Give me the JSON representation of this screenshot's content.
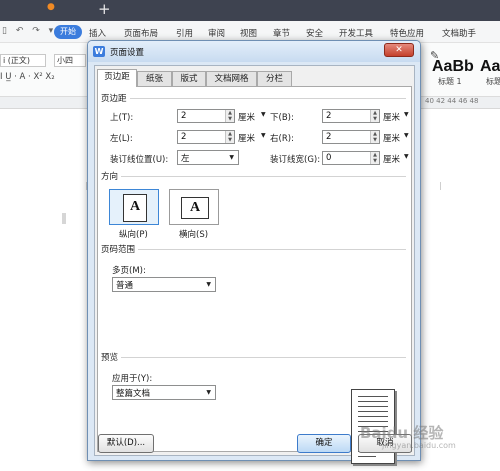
{
  "app": {
    "menu_start": "开始",
    "menus": [
      "插入",
      "页面布局",
      "引用",
      "审阅",
      "视图",
      "章节",
      "安全",
      "开发工具",
      "特色应用",
      "文档助手"
    ],
    "font_name": "i (正文)",
    "font_size": "小四",
    "style_previews": [
      {
        "preview": "AaBb",
        "name": "标题 1"
      },
      {
        "preview": "AaI",
        "name": "标题"
      }
    ],
    "ruler_nums": "40 42 44 46 48"
  },
  "dialog": {
    "title": "页面设置",
    "close_glyph": "✕",
    "tabs": [
      "页边距",
      "纸张",
      "版式",
      "文档网格",
      "分栏"
    ],
    "margins": {
      "section": "页边距",
      "top_label": "上(T):",
      "top_value": "2",
      "bottom_label": "下(B):",
      "bottom_value": "2",
      "left_label": "左(L):",
      "left_value": "2",
      "right_label": "右(R):",
      "right_value": "2",
      "gutter_pos_label": "装订线位置(U):",
      "gutter_pos_value": "左",
      "gutter_width_label": "装订线宽(G):",
      "gutter_width_value": "0",
      "unit": "厘米"
    },
    "orientation": {
      "section": "方向",
      "portrait_label": "纵向(P)",
      "landscape_label": "横向(S)",
      "glyph": "A"
    },
    "page_range": {
      "section": "页码范围",
      "multi_label": "多页(M):",
      "multi_value": "普通"
    },
    "preview": {
      "section": "预览",
      "apply_label": "应用于(Y):",
      "apply_value": "整篇文档"
    },
    "buttons": {
      "default": "默认(D)...",
      "ok": "确定",
      "cancel": "取消"
    }
  },
  "watermark": {
    "text": "Baidu 经验",
    "sub": "jingyan.baidu.com"
  }
}
